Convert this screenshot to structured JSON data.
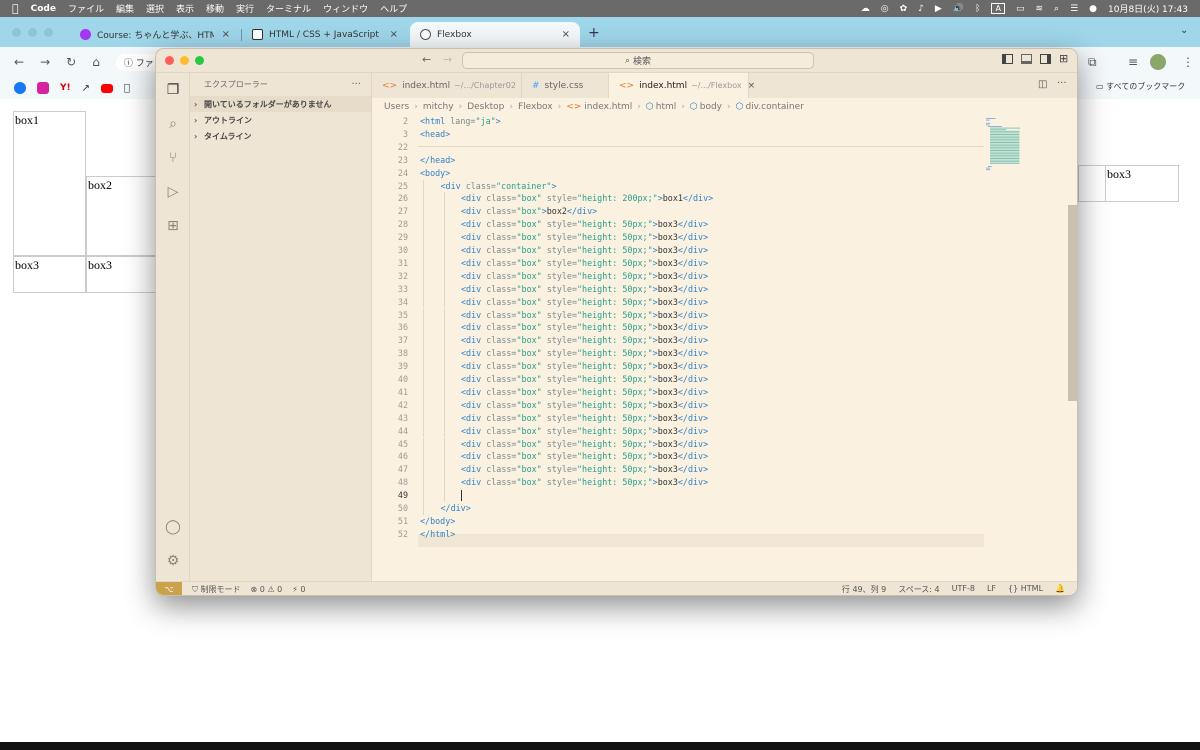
{
  "menubar": {
    "apple": "",
    "app": "Code",
    "menus": [
      "ファイル",
      "編集",
      "選択",
      "表示",
      "移動",
      "実行",
      "ターミナル",
      "ウィンドウ",
      "ヘルプ"
    ],
    "clock": "10月8日(火) 17:43",
    "input_source": "A"
  },
  "browser": {
    "tabs": [
      {
        "title": "Course: ちゃんと学ぶ、HTML/(",
        "close": "×"
      },
      {
        "title": "HTML / CSS + JavaScript No",
        "close": "×"
      },
      {
        "title": "Flexbox",
        "close": "×"
      }
    ],
    "new_tab": "+",
    "address_partial": "ファ",
    "bookmarks_all": "すべてのブックマーク"
  },
  "page": {
    "boxes": [
      "box1",
      "box2",
      "box3",
      "box3",
      "box3"
    ]
  },
  "vscode": {
    "search": "検索",
    "explorer_title": "エクスプローラー",
    "explorer_more": "···",
    "sections": [
      "開いているフォルダーがありません",
      "アウトライン",
      "タイムライン"
    ],
    "tabs": [
      {
        "name": "index.html",
        "path": "~/.../Chapter02",
        "icon": "<>"
      },
      {
        "name": "style.css",
        "path": "",
        "icon": "#"
      },
      {
        "name": "index.html",
        "path": "~/.../Flexbox",
        "icon": "<>",
        "close": "×"
      }
    ],
    "breadcrumb": [
      "Users",
      "mitchy",
      "Desktop",
      "Flexbox",
      "index.html",
      "html",
      "body",
      "div.container"
    ],
    "status": {
      "mode": "制限モード",
      "errors": "0",
      "warnings": "0",
      "ports": "0",
      "position": "行 49、列 9",
      "spaces": "スペース: 4",
      "encoding": "UTF-8",
      "eol": "LF",
      "language": "HTML"
    },
    "code": [
      {
        "n": "2",
        "t": [
          [
            "tag",
            "<html "
          ],
          [
            "attr",
            "lang="
          ],
          [
            "str",
            "\"ja\""
          ],
          [
            "tag",
            ">"
          ]
        ],
        "i": 0
      },
      {
        "n": "3",
        "t": [
          [
            "tag",
            "<head>"
          ]
        ],
        "i": 0
      },
      {
        "n": "22",
        "t": [],
        "i": 0
      },
      {
        "n": "23",
        "t": [
          [
            "tag",
            "</head>"
          ]
        ],
        "i": 0
      },
      {
        "n": "24",
        "t": [
          [
            "tag",
            "<body>"
          ]
        ],
        "i": 0
      },
      {
        "n": "25",
        "t": [
          [
            "tag",
            "<div "
          ],
          [
            "attr",
            "class="
          ],
          [
            "str",
            "\"container\""
          ],
          [
            "tag",
            ">"
          ]
        ],
        "i": 1
      },
      {
        "n": "26",
        "t": [
          [
            "tag",
            "<div "
          ],
          [
            "attr",
            "class="
          ],
          [
            "str",
            "\"box\""
          ],
          [
            "attr",
            " style="
          ],
          [
            "str",
            "\"height: 200px;\""
          ],
          [
            "tag",
            ">"
          ],
          [
            "txt",
            "box1"
          ],
          [
            "tag",
            "</div>"
          ]
        ],
        "i": 2
      },
      {
        "n": "27",
        "t": [
          [
            "tag",
            "<div "
          ],
          [
            "attr",
            "class="
          ],
          [
            "str",
            "\"box\""
          ],
          [
            "tag",
            ">"
          ],
          [
            "txt",
            "box2"
          ],
          [
            "tag",
            "</div>"
          ]
        ],
        "i": 2
      },
      {
        "n": "28",
        "t": [
          [
            "tag",
            "<div "
          ],
          [
            "attr",
            "class="
          ],
          [
            "str",
            "\"box\""
          ],
          [
            "attr",
            " style="
          ],
          [
            "str",
            "\"height: 50px;\""
          ],
          [
            "tag",
            ">"
          ],
          [
            "txt",
            "box3"
          ],
          [
            "tag",
            "</div>"
          ]
        ],
        "i": 2
      },
      {
        "n": "29",
        "t": [
          [
            "tag",
            "<div "
          ],
          [
            "attr",
            "class="
          ],
          [
            "str",
            "\"box\""
          ],
          [
            "attr",
            " style="
          ],
          [
            "str",
            "\"height: 50px;\""
          ],
          [
            "tag",
            ">"
          ],
          [
            "txt",
            "box3"
          ],
          [
            "tag",
            "</div>"
          ]
        ],
        "i": 2
      },
      {
        "n": "30",
        "t": [
          [
            "tag",
            "<div "
          ],
          [
            "attr",
            "class="
          ],
          [
            "str",
            "\"box\""
          ],
          [
            "attr",
            " style="
          ],
          [
            "str",
            "\"height: 50px;\""
          ],
          [
            "tag",
            ">"
          ],
          [
            "txt",
            "box3"
          ],
          [
            "tag",
            "</div>"
          ]
        ],
        "i": 2
      },
      {
        "n": "31",
        "t": [
          [
            "tag",
            "<div "
          ],
          [
            "attr",
            "class="
          ],
          [
            "str",
            "\"box\""
          ],
          [
            "attr",
            " style="
          ],
          [
            "str",
            "\"height: 50px;\""
          ],
          [
            "tag",
            ">"
          ],
          [
            "txt",
            "box3"
          ],
          [
            "tag",
            "</div>"
          ]
        ],
        "i": 2
      },
      {
        "n": "32",
        "t": [
          [
            "tag",
            "<div "
          ],
          [
            "attr",
            "class="
          ],
          [
            "str",
            "\"box\""
          ],
          [
            "attr",
            " style="
          ],
          [
            "str",
            "\"height: 50px;\""
          ],
          [
            "tag",
            ">"
          ],
          [
            "txt",
            "box3"
          ],
          [
            "tag",
            "</div>"
          ]
        ],
        "i": 2
      },
      {
        "n": "33",
        "t": [
          [
            "tag",
            "<div "
          ],
          [
            "attr",
            "class="
          ],
          [
            "str",
            "\"box\""
          ],
          [
            "attr",
            " style="
          ],
          [
            "str",
            "\"height: 50px;\""
          ],
          [
            "tag",
            ">"
          ],
          [
            "txt",
            "box3"
          ],
          [
            "tag",
            "</div>"
          ]
        ],
        "i": 2
      },
      {
        "n": "34",
        "t": [
          [
            "tag",
            "<div "
          ],
          [
            "attr",
            "class="
          ],
          [
            "str",
            "\"box\""
          ],
          [
            "attr",
            " style="
          ],
          [
            "str",
            "\"height: 50px;\""
          ],
          [
            "tag",
            ">"
          ],
          [
            "txt",
            "box3"
          ],
          [
            "tag",
            "</div>"
          ]
        ],
        "i": 2
      },
      {
        "n": "35",
        "t": [
          [
            "tag",
            "<div "
          ],
          [
            "attr",
            "class="
          ],
          [
            "str",
            "\"box\""
          ],
          [
            "attr",
            " style="
          ],
          [
            "str",
            "\"height: 50px;\""
          ],
          [
            "tag",
            ">"
          ],
          [
            "txt",
            "box3"
          ],
          [
            "tag",
            "</div>"
          ]
        ],
        "i": 2
      },
      {
        "n": "36",
        "t": [
          [
            "tag",
            "<div "
          ],
          [
            "attr",
            "class="
          ],
          [
            "str",
            "\"box\""
          ],
          [
            "attr",
            " style="
          ],
          [
            "str",
            "\"height: 50px;\""
          ],
          [
            "tag",
            ">"
          ],
          [
            "txt",
            "box3"
          ],
          [
            "tag",
            "</div>"
          ]
        ],
        "i": 2
      },
      {
        "n": "37",
        "t": [
          [
            "tag",
            "<div "
          ],
          [
            "attr",
            "class="
          ],
          [
            "str",
            "\"box\""
          ],
          [
            "attr",
            " style="
          ],
          [
            "str",
            "\"height: 50px;\""
          ],
          [
            "tag",
            ">"
          ],
          [
            "txt",
            "box3"
          ],
          [
            "tag",
            "</div>"
          ]
        ],
        "i": 2
      },
      {
        "n": "38",
        "t": [
          [
            "tag",
            "<div "
          ],
          [
            "attr",
            "class="
          ],
          [
            "str",
            "\"box\""
          ],
          [
            "attr",
            " style="
          ],
          [
            "str",
            "\"height: 50px;\""
          ],
          [
            "tag",
            ">"
          ],
          [
            "txt",
            "box3"
          ],
          [
            "tag",
            "</div>"
          ]
        ],
        "i": 2
      },
      {
        "n": "39",
        "t": [
          [
            "tag",
            "<div "
          ],
          [
            "attr",
            "class="
          ],
          [
            "str",
            "\"box\""
          ],
          [
            "attr",
            " style="
          ],
          [
            "str",
            "\"height: 50px;\""
          ],
          [
            "tag",
            ">"
          ],
          [
            "txt",
            "box3"
          ],
          [
            "tag",
            "</div>"
          ]
        ],
        "i": 2
      },
      {
        "n": "40",
        "t": [
          [
            "tag",
            "<div "
          ],
          [
            "attr",
            "class="
          ],
          [
            "str",
            "\"box\""
          ],
          [
            "attr",
            " style="
          ],
          [
            "str",
            "\"height: 50px;\""
          ],
          [
            "tag",
            ">"
          ],
          [
            "txt",
            "box3"
          ],
          [
            "tag",
            "</div>"
          ]
        ],
        "i": 2
      },
      {
        "n": "41",
        "t": [
          [
            "tag",
            "<div "
          ],
          [
            "attr",
            "class="
          ],
          [
            "str",
            "\"box\""
          ],
          [
            "attr",
            " style="
          ],
          [
            "str",
            "\"height: 50px;\""
          ],
          [
            "tag",
            ">"
          ],
          [
            "txt",
            "box3"
          ],
          [
            "tag",
            "</div>"
          ]
        ],
        "i": 2
      },
      {
        "n": "42",
        "t": [
          [
            "tag",
            "<div "
          ],
          [
            "attr",
            "class="
          ],
          [
            "str",
            "\"box\""
          ],
          [
            "attr",
            " style="
          ],
          [
            "str",
            "\"height: 50px;\""
          ],
          [
            "tag",
            ">"
          ],
          [
            "txt",
            "box3"
          ],
          [
            "tag",
            "</div>"
          ]
        ],
        "i": 2
      },
      {
        "n": "43",
        "t": [
          [
            "tag",
            "<div "
          ],
          [
            "attr",
            "class="
          ],
          [
            "str",
            "\"box\""
          ],
          [
            "attr",
            " style="
          ],
          [
            "str",
            "\"height: 50px;\""
          ],
          [
            "tag",
            ">"
          ],
          [
            "txt",
            "box3"
          ],
          [
            "tag",
            "</div>"
          ]
        ],
        "i": 2
      },
      {
        "n": "44",
        "t": [
          [
            "tag",
            "<div "
          ],
          [
            "attr",
            "class="
          ],
          [
            "str",
            "\"box\""
          ],
          [
            "attr",
            " style="
          ],
          [
            "str",
            "\"height: 50px;\""
          ],
          [
            "tag",
            ">"
          ],
          [
            "txt",
            "box3"
          ],
          [
            "tag",
            "</div>"
          ]
        ],
        "i": 2
      },
      {
        "n": "45",
        "t": [
          [
            "tag",
            "<div "
          ],
          [
            "attr",
            "class="
          ],
          [
            "str",
            "\"box\""
          ],
          [
            "attr",
            " style="
          ],
          [
            "str",
            "\"height: 50px;\""
          ],
          [
            "tag",
            ">"
          ],
          [
            "txt",
            "box3"
          ],
          [
            "tag",
            "</div>"
          ]
        ],
        "i": 2
      },
      {
        "n": "46",
        "t": [
          [
            "tag",
            "<div "
          ],
          [
            "attr",
            "class="
          ],
          [
            "str",
            "\"box\""
          ],
          [
            "attr",
            " style="
          ],
          [
            "str",
            "\"height: 50px;\""
          ],
          [
            "tag",
            ">"
          ],
          [
            "txt",
            "box3"
          ],
          [
            "tag",
            "</div>"
          ]
        ],
        "i": 2
      },
      {
        "n": "47",
        "t": [
          [
            "tag",
            "<div "
          ],
          [
            "attr",
            "class="
          ],
          [
            "str",
            "\"box\""
          ],
          [
            "attr",
            " style="
          ],
          [
            "str",
            "\"height: 50px;\""
          ],
          [
            "tag",
            ">"
          ],
          [
            "txt",
            "box3"
          ],
          [
            "tag",
            "</div>"
          ]
        ],
        "i": 2
      },
      {
        "n": "48",
        "t": [
          [
            "tag",
            "<div "
          ],
          [
            "attr",
            "class="
          ],
          [
            "str",
            "\"box\""
          ],
          [
            "attr",
            " style="
          ],
          [
            "str",
            "\"height: 50px;\""
          ],
          [
            "tag",
            ">"
          ],
          [
            "txt",
            "box3"
          ],
          [
            "tag",
            "</div>"
          ]
        ],
        "i": 2
      },
      {
        "n": "49",
        "t": [],
        "i": 2
      },
      {
        "n": "50",
        "t": [
          [
            "tag",
            "</div>"
          ]
        ],
        "i": 1
      },
      {
        "n": "51",
        "t": [
          [
            "tag",
            "</body>"
          ]
        ],
        "i": 0
      },
      {
        "n": "52",
        "t": [
          [
            "tag",
            "</html>"
          ]
        ],
        "i": 0
      }
    ]
  },
  "colors": {
    "accent": "#2f83c8",
    "string": "#27a08e",
    "attr": "#7a8a8f",
    "tabbar": "#9fd6ea",
    "editor_bg": "#fbf1e0"
  }
}
